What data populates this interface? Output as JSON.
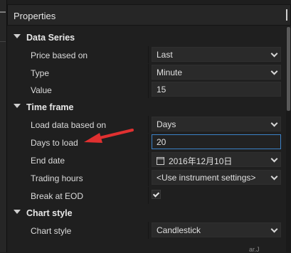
{
  "panel": {
    "title": "Properties"
  },
  "categories": {
    "data_series": "Data Series",
    "time_frame": "Time frame",
    "chart_style": "Chart style"
  },
  "rows": {
    "price_based_on": {
      "label": "Price based on",
      "value": "Last"
    },
    "type": {
      "label": "Type",
      "value": "Minute"
    },
    "value": {
      "label": "Value",
      "value": "15"
    },
    "load_data_based_on": {
      "label": "Load data based on",
      "value": "Days"
    },
    "days_to_load": {
      "label": "Days to load",
      "value": "20"
    },
    "end_date": {
      "label": "End date",
      "value": "2016年12月10日"
    },
    "trading_hours": {
      "label": "Trading hours",
      "value": "<Use instrument settings>"
    },
    "break_at_eod": {
      "label": "Break at EOD",
      "checked": true
    },
    "chart_style": {
      "label": "Chart style",
      "value": "Candlestick"
    }
  },
  "annotation": {
    "color": "#e03030"
  },
  "footer": {
    "partial_text": "ar.J"
  }
}
